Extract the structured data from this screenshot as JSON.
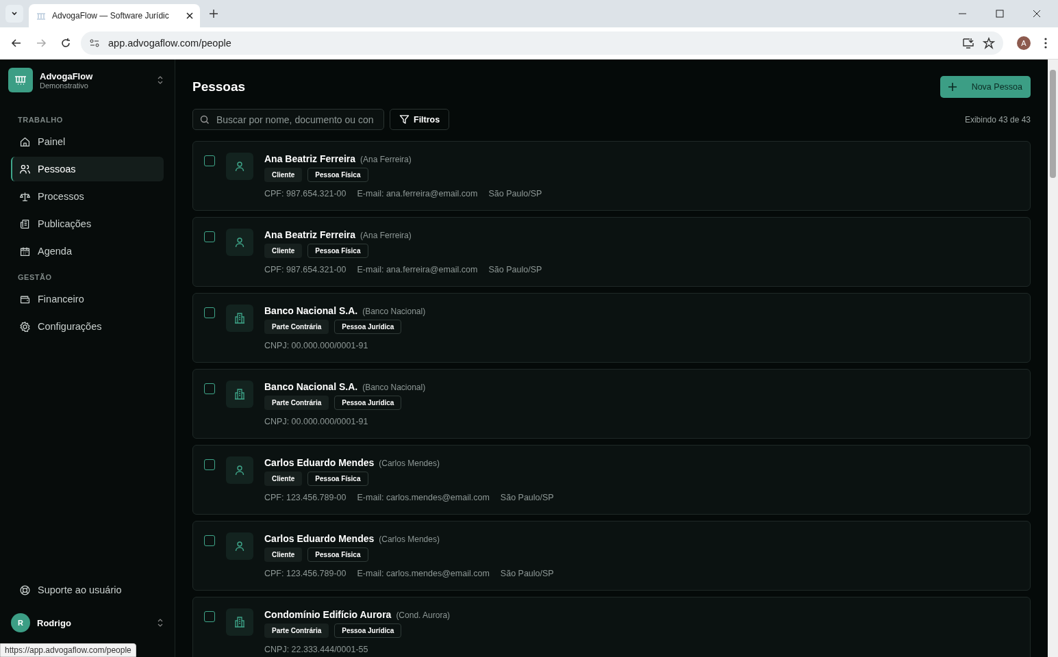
{
  "browser": {
    "tab_title": "AdvogaFlow — Software Jurídic",
    "url": "app.advogaflow.com/people",
    "profile_initial": "A",
    "status_url": "https://app.advogaflow.com/people"
  },
  "sidebar": {
    "org": {
      "name": "AdvogaFlow",
      "subtitle": "Demonstrativo"
    },
    "sections": [
      {
        "title": "TRABALHO",
        "items": [
          {
            "label": "Painel",
            "selected": false
          },
          {
            "label": "Pessoas",
            "selected": true
          },
          {
            "label": "Processos",
            "selected": false
          },
          {
            "label": "Publicações",
            "selected": false
          },
          {
            "label": "Agenda",
            "selected": false
          }
        ]
      },
      {
        "title": "GESTÃO",
        "items": [
          {
            "label": "Financeiro",
            "selected": false
          },
          {
            "label": "Configurações",
            "selected": false
          }
        ]
      }
    ],
    "support": "Suporte ao usuário",
    "user": {
      "initial": "R",
      "name": "Rodrigo"
    }
  },
  "page": {
    "title": "Pessoas",
    "new_button": "Nova Pessoa",
    "search": {
      "placeholder": "Buscar por nome, documento ou con"
    },
    "filter_button": "Filtros",
    "count": "Exibindo 43 de 43"
  },
  "people": [
    {
      "kind": "person",
      "checked": false,
      "name": "Ana Beatriz Ferreira",
      "nickname": "(Ana Ferreira)",
      "tags": [
        {
          "label": "Cliente",
          "kind": "filled"
        },
        {
          "label": "Pessoa Física",
          "kind": "outline"
        }
      ],
      "details": [
        "CPF: 987.654.321-00",
        "E-mail: ana.ferreira@email.com",
        "São Paulo/SP"
      ]
    },
    {
      "kind": "person",
      "checked": false,
      "name": "Ana Beatriz Ferreira",
      "nickname": "(Ana Ferreira)",
      "tags": [
        {
          "label": "Cliente",
          "kind": "filled"
        },
        {
          "label": "Pessoa Física",
          "kind": "outline"
        }
      ],
      "details": [
        "CPF: 987.654.321-00",
        "E-mail: ana.ferreira@email.com",
        "São Paulo/SP"
      ]
    },
    {
      "kind": "company",
      "checked": false,
      "name": "Banco Nacional S.A.",
      "nickname": "(Banco Nacional)",
      "tags": [
        {
          "label": "Parte Contrária",
          "kind": "filled"
        },
        {
          "label": "Pessoa Jurídica",
          "kind": "outline"
        }
      ],
      "details": [
        "CNPJ: 00.000.000/0001-91"
      ]
    },
    {
      "kind": "company",
      "checked": false,
      "name": "Banco Nacional S.A.",
      "nickname": "(Banco Nacional)",
      "tags": [
        {
          "label": "Parte Contrária",
          "kind": "filled"
        },
        {
          "label": "Pessoa Jurídica",
          "kind": "outline"
        }
      ],
      "details": [
        "CNPJ: 00.000.000/0001-91"
      ]
    },
    {
      "kind": "person",
      "checked": false,
      "name": "Carlos Eduardo Mendes",
      "nickname": "(Carlos Mendes)",
      "tags": [
        {
          "label": "Cliente",
          "kind": "filled"
        },
        {
          "label": "Pessoa Física",
          "kind": "outline"
        }
      ],
      "details": [
        "CPF: 123.456.789-00",
        "E-mail: carlos.mendes@email.com",
        "São Paulo/SP"
      ]
    },
    {
      "kind": "person",
      "checked": false,
      "name": "Carlos Eduardo Mendes",
      "nickname": "(Carlos Mendes)",
      "tags": [
        {
          "label": "Cliente",
          "kind": "filled"
        },
        {
          "label": "Pessoa Física",
          "kind": "outline"
        }
      ],
      "details": [
        "CPF: 123.456.789-00",
        "E-mail: carlos.mendes@email.com",
        "São Paulo/SP"
      ]
    },
    {
      "kind": "company",
      "checked": false,
      "name": "Condomínio Edifício Aurora",
      "nickname": "(Cond. Aurora)",
      "tags": [
        {
          "label": "Parte Contrária",
          "kind": "filled"
        },
        {
          "label": "Pessoa Jurídica",
          "kind": "outline"
        }
      ],
      "details": [
        "CNPJ: 22.333.444/0001-55"
      ]
    }
  ]
}
